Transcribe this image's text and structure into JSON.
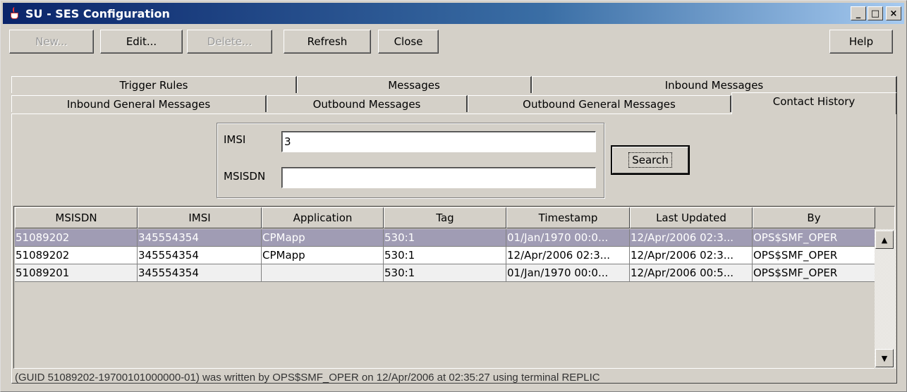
{
  "window": {
    "title": "SU - SES Configuration",
    "controls": {
      "minimize": "_",
      "maximize": "□",
      "close": "×"
    }
  },
  "toolbar": {
    "new_label": "New...",
    "edit_label": "Edit...",
    "delete_label": "Delete...",
    "refresh_label": "Refresh",
    "close_label": "Close",
    "help_label": "Help"
  },
  "tabs": {
    "row1": [
      "Trigger Rules",
      "Messages",
      "Inbound Messages"
    ],
    "row2": [
      "Inbound General Messages",
      "Outbound Messages",
      "Outbound General Messages",
      "Contact History"
    ],
    "selected": "Contact History"
  },
  "search": {
    "imsi_label": "IMSI",
    "imsi_value": "3",
    "msisdn_label": "MSISDN",
    "msisdn_value": "",
    "button_label": "Search"
  },
  "table": {
    "columns": [
      "MSISDN",
      "IMSI",
      "Application",
      "Tag",
      "Timestamp",
      "Last Updated",
      "By"
    ],
    "rows": [
      [
        "51089202",
        "345554354",
        "CPMapp",
        "530:1",
        "01/Jan/1970 00:0...",
        "12/Apr/2006 02:3...",
        "OPS$SMF_OPER"
      ],
      [
        "51089202",
        "345554354",
        "CPMapp",
        "530:1",
        "12/Apr/2006 02:3...",
        "12/Apr/2006 02:3...",
        "OPS$SMF_OPER"
      ],
      [
        "51089201",
        "345554354",
        "",
        "530:1",
        "01/Jan/1970 00:0...",
        "12/Apr/2006 00:5...",
        "OPS$SMF_OPER"
      ]
    ],
    "selected_row": 0
  },
  "status_text": "(GUID 51089202-19700101000000-01) was written by OPS$SMF_OPER on 12/Apr/2006 at 02:35:27 using terminal REPLIC"
}
